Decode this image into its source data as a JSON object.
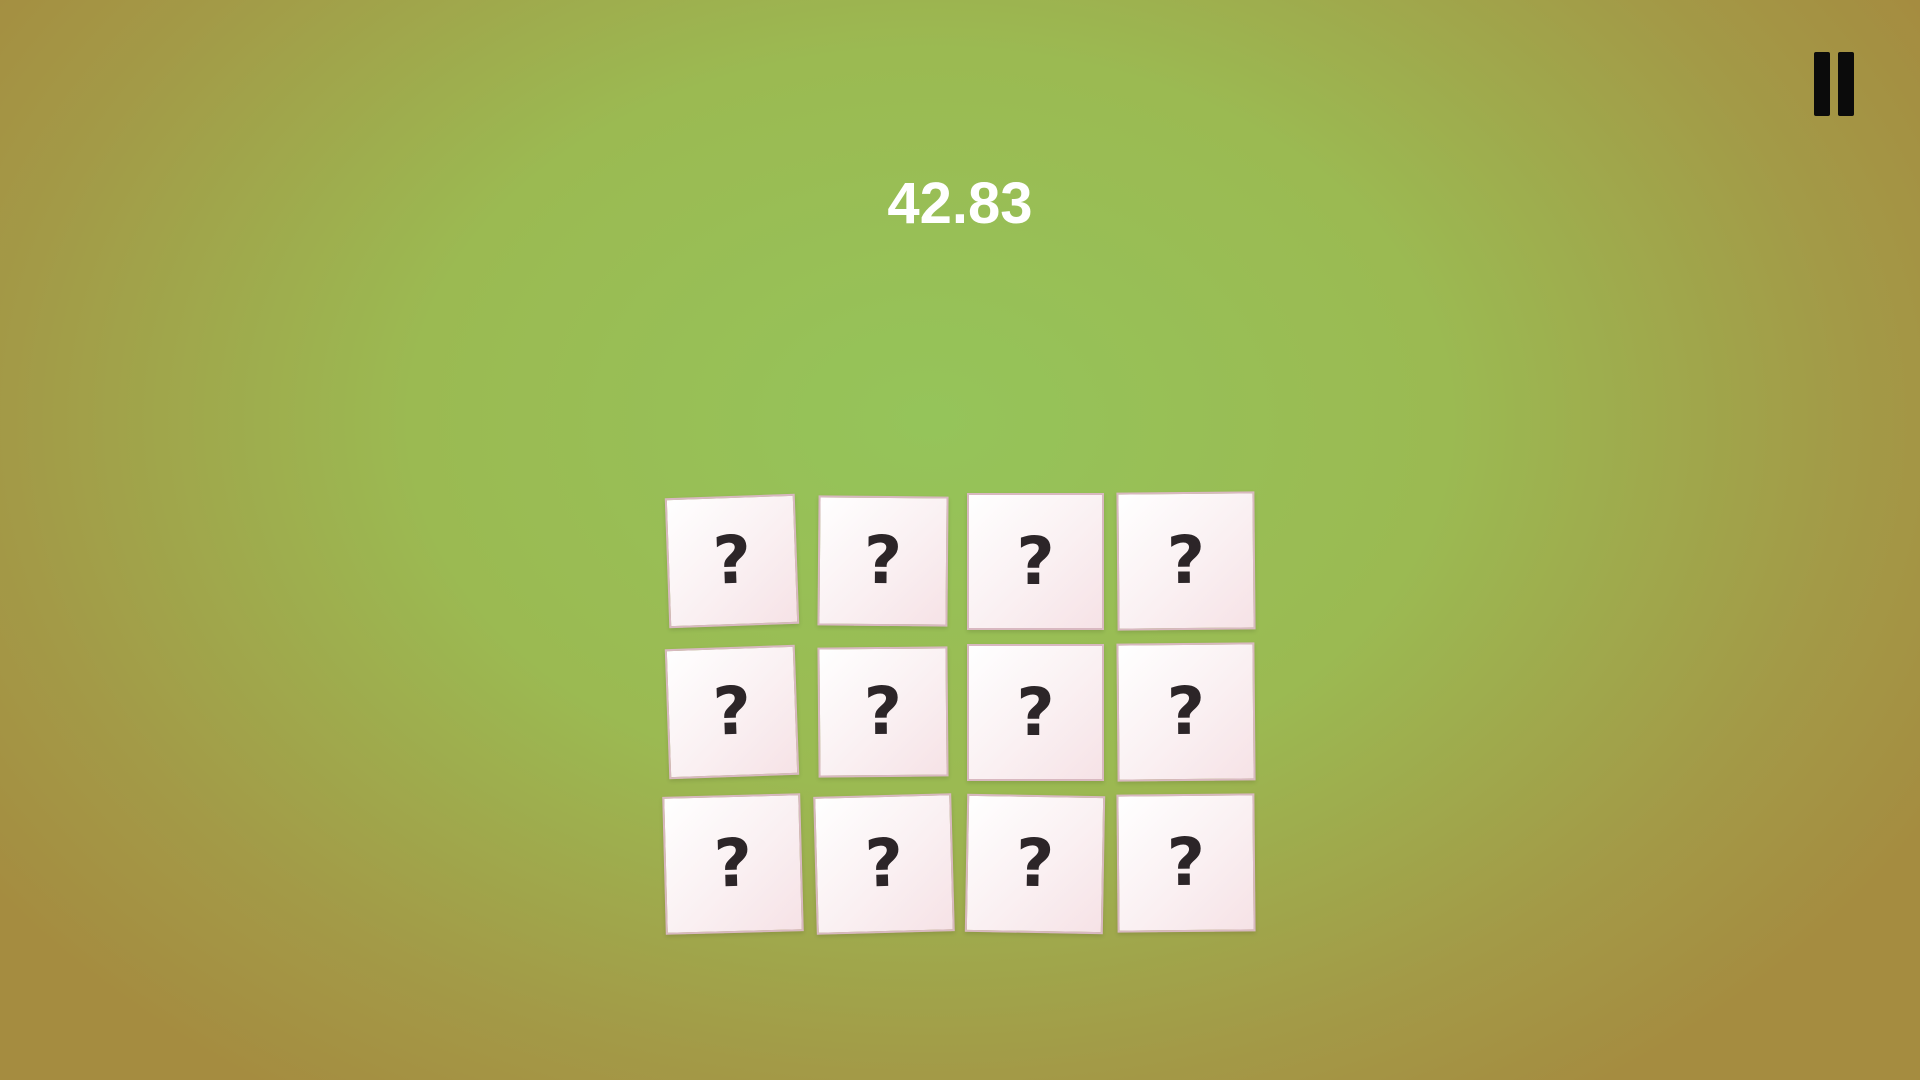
{
  "hud": {
    "timer": "42.83"
  },
  "icons": {
    "pause": "pause-icon"
  },
  "board": {
    "rows": 3,
    "cols": 4,
    "cards": [
      {
        "symbol": "?",
        "state": "face-down"
      },
      {
        "symbol": "?",
        "state": "face-down"
      },
      {
        "symbol": "?",
        "state": "face-down"
      },
      {
        "symbol": "?",
        "state": "face-down"
      },
      {
        "symbol": "?",
        "state": "face-down"
      },
      {
        "symbol": "?",
        "state": "face-down"
      },
      {
        "symbol": "?",
        "state": "face-down"
      },
      {
        "symbol": "?",
        "state": "face-down"
      },
      {
        "symbol": "?",
        "state": "face-down"
      },
      {
        "symbol": "?",
        "state": "face-down"
      },
      {
        "symbol": "?",
        "state": "face-down"
      },
      {
        "symbol": "?",
        "state": "face-down"
      }
    ]
  }
}
